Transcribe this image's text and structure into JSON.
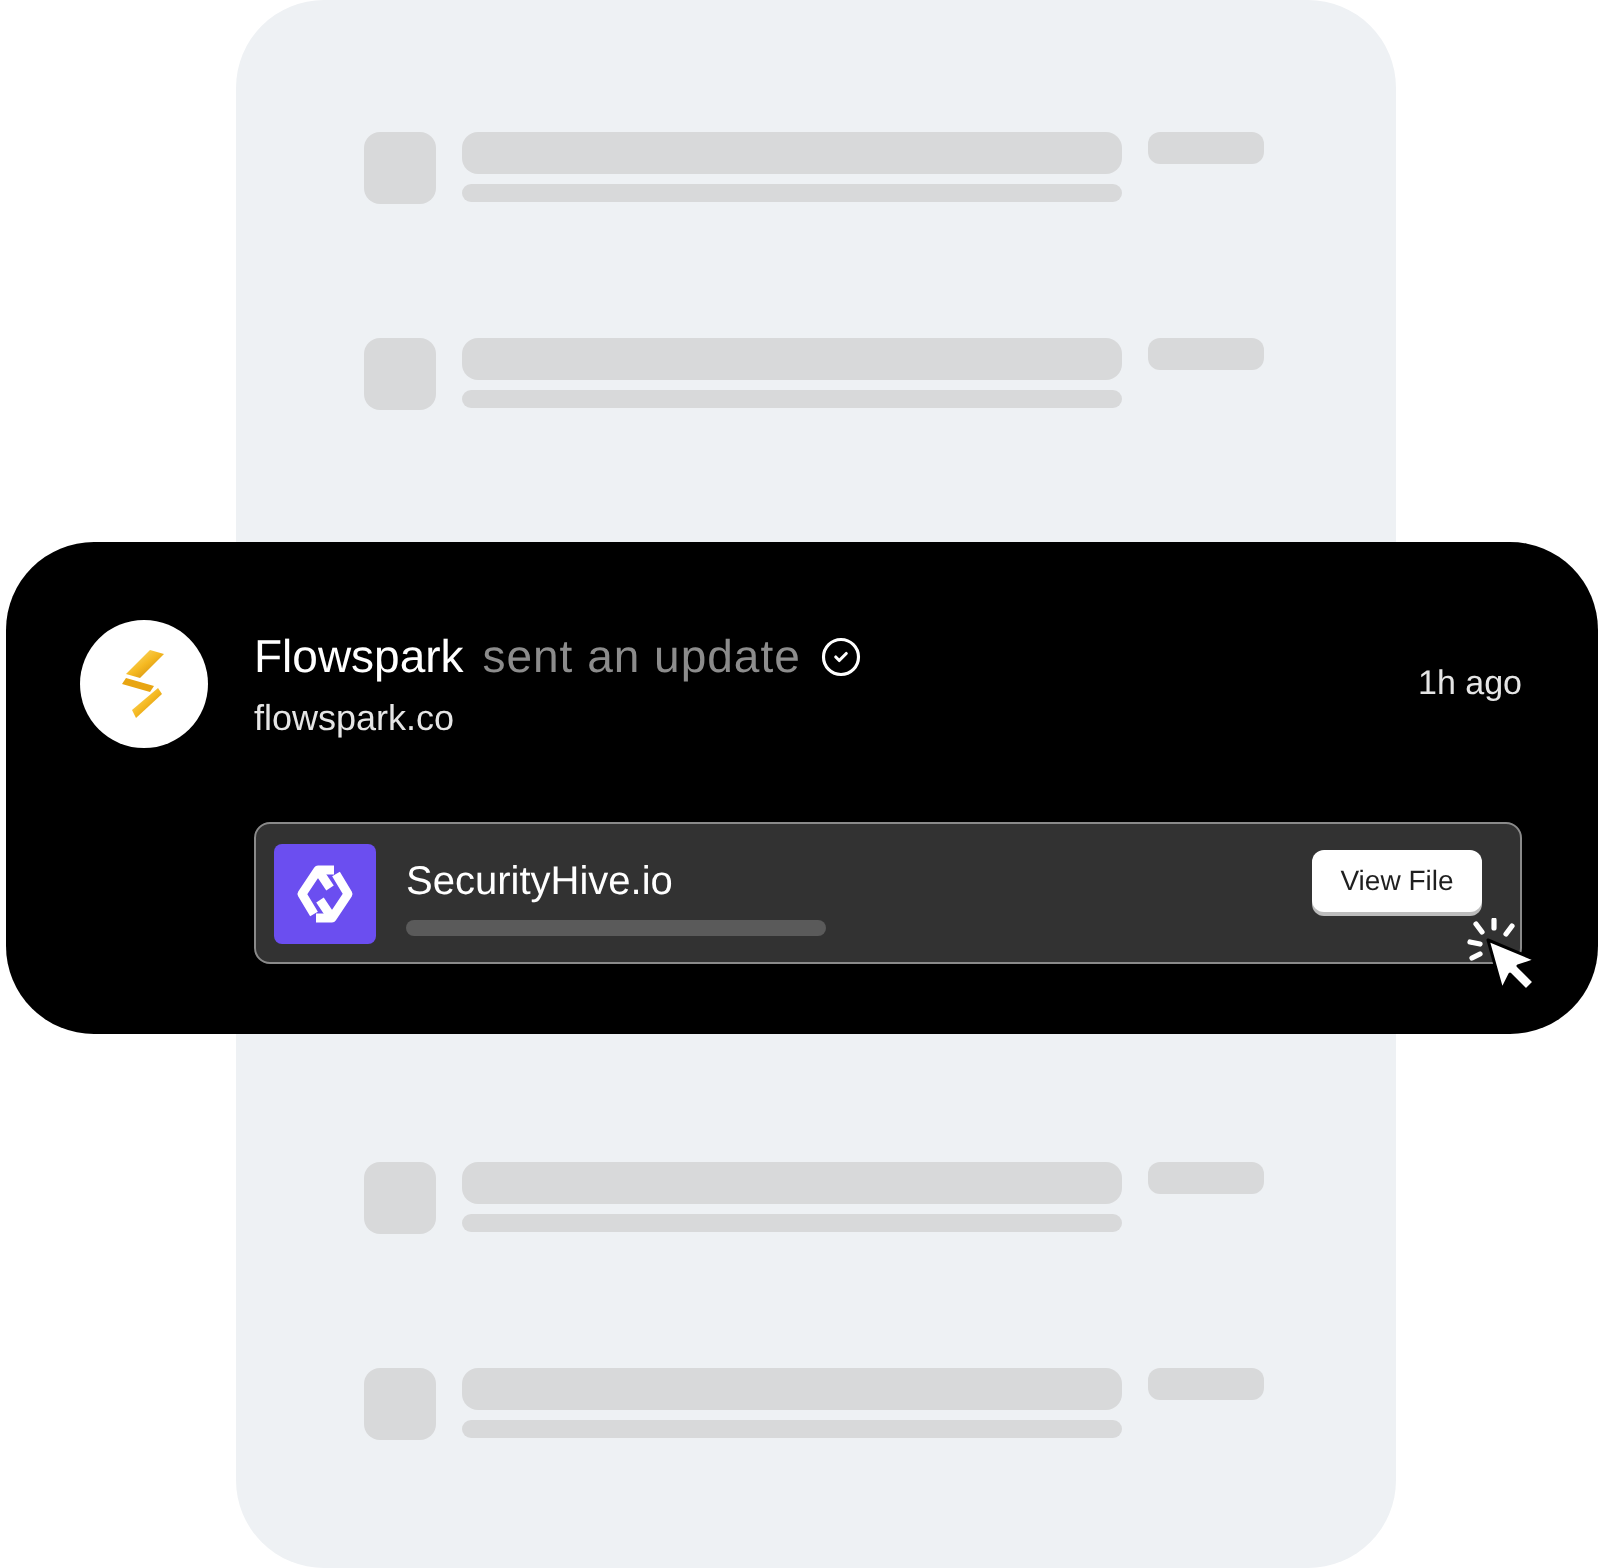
{
  "notification": {
    "sender": "Flowspark",
    "action": "sent an update",
    "verified": true,
    "domain": "flowspark.co",
    "time": "1h ago",
    "attachment": {
      "name": "SecurityHive.io",
      "button": "View File"
    }
  }
}
